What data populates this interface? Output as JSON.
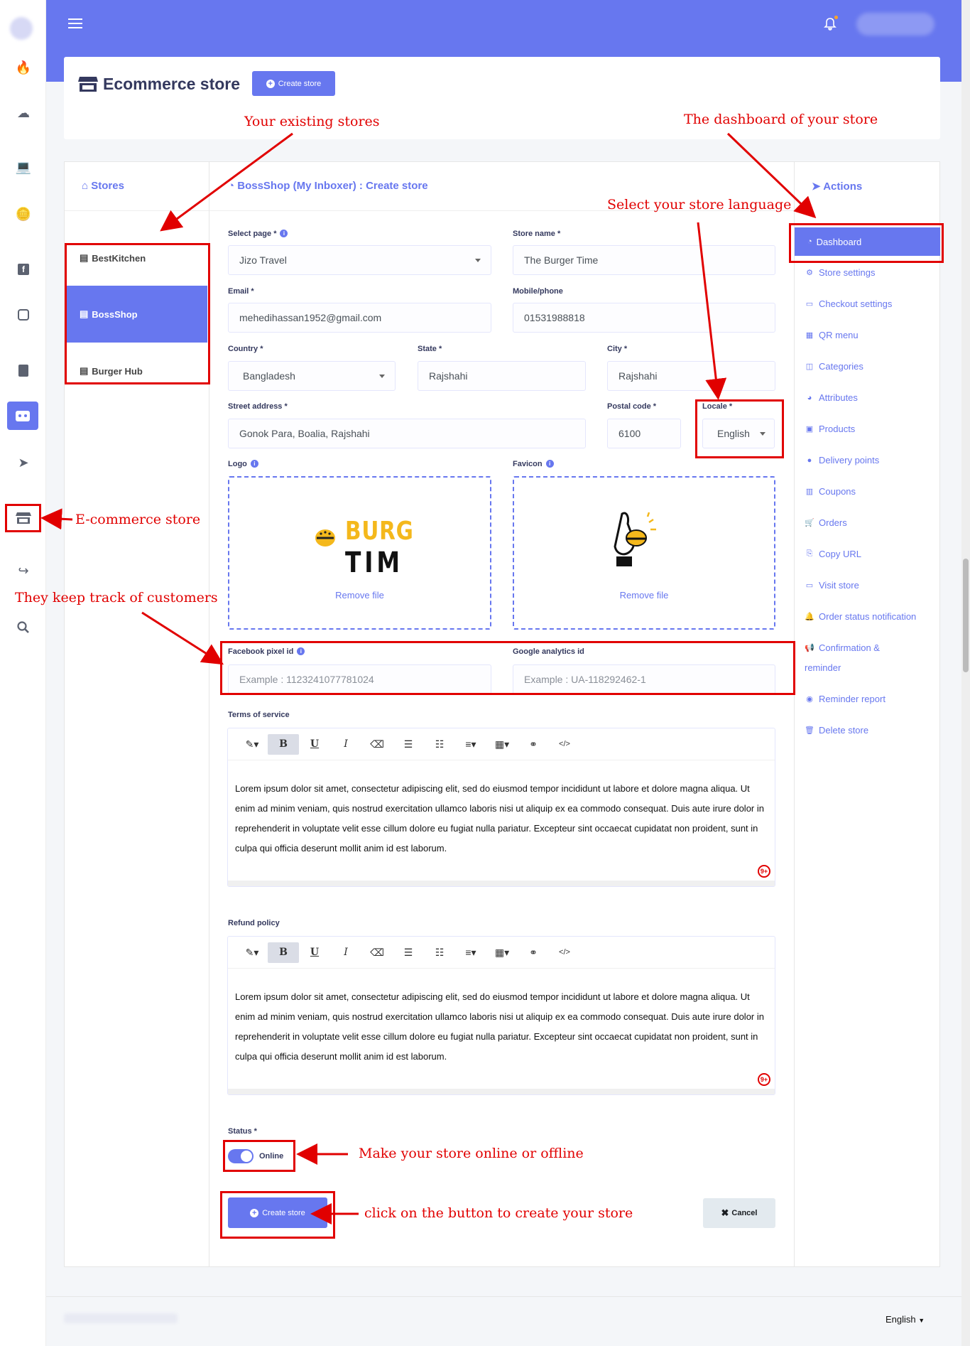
{
  "header": {
    "title": "Ecommerce store",
    "create_button": "Create store",
    "menu_icon": "hamburger-icon",
    "bell_icon": "bell-icon"
  },
  "stores_panel": {
    "heading": "Stores",
    "items": [
      "BestKitchen",
      "BossShop",
      "Burger Hub"
    ],
    "active": "BossShop"
  },
  "form": {
    "heading": "BossShop (My Inboxer) : Create store",
    "select_page": {
      "label": "Select page *",
      "value": "Jizo Travel"
    },
    "store_name": {
      "label": "Store name *",
      "value": "The Burger Time"
    },
    "email": {
      "label": "Email *",
      "value": "mehedihassan1952@gmail.com"
    },
    "mobile": {
      "label": "Mobile/phone",
      "value": "01531988818"
    },
    "country": {
      "label": "Country *",
      "value": "Bangladesh"
    },
    "state": {
      "label": "State *",
      "value": "Rajshahi"
    },
    "city": {
      "label": "City *",
      "value": "Rajshahi"
    },
    "street": {
      "label": "Street address *",
      "value": "Gonok Para, Boalia, Rajshahi"
    },
    "postal": {
      "label": "Postal code *",
      "value": "6100"
    },
    "locale": {
      "label": "Locale *",
      "value": "English"
    },
    "logo": {
      "label": "Logo",
      "remove": "Remove file",
      "logo_text_1": "BURG",
      "logo_text_2": "TIM"
    },
    "favicon": {
      "label": "Favicon",
      "remove": "Remove file"
    },
    "fb_pixel": {
      "label": "Facebook pixel id",
      "placeholder": "Example : 1123241077781024"
    },
    "ga_id": {
      "label": "Google analytics id",
      "placeholder": "Example : UA-118292462-1"
    },
    "terms": {
      "label": "Terms of service"
    },
    "refund": {
      "label": "Refund policy"
    },
    "editor_text": "Lorem ipsum dolor sit amet, consectetur adipiscing elit, sed do eiusmod tempor incididunt ut labore et dolore magna aliqua. Ut enim ad minim veniam, quis nostrud exercitation ullamco laboris nisi ut aliquip ex ea commodo consequat. Duis aute irure dolor in reprehenderit in voluptate velit esse cillum dolore eu fugiat nulla pariatur. Excepteur sint occaecat cupidatat non proident, sunt in culpa qui officia deserunt mollit anim id est laborum.",
    "editor_badge": "9+",
    "toolbar": {
      "bold": "B",
      "underline": "U",
      "italic": "I",
      "code": "</>"
    },
    "status": {
      "label": "Status *",
      "value": "Online"
    },
    "submit": "Create store",
    "cancel": "Cancel"
  },
  "actions": {
    "heading": "Actions",
    "items": [
      "Dashboard",
      "Store settings",
      "Checkout settings",
      "QR menu",
      "Categories",
      "Attributes",
      "Products",
      "Delivery points",
      "Coupons",
      "Orders",
      "Copy URL",
      "Visit store",
      "Order status notification",
      "Confirmation &",
      "reminder",
      "Reminder report",
      "Delete store"
    ]
  },
  "annotations": {
    "existing": "Your existing stores",
    "dashboard": "The dashboard of your store",
    "language": "Select your store language",
    "ecommerce": "E-commerce store",
    "track": "They keep track of customers",
    "online": "Make your store online or offline",
    "click": "click on the button to create your store"
  },
  "footer": {
    "lang": "English"
  },
  "colors": {
    "primary": "#6777ef",
    "annotation": "#e10000"
  }
}
